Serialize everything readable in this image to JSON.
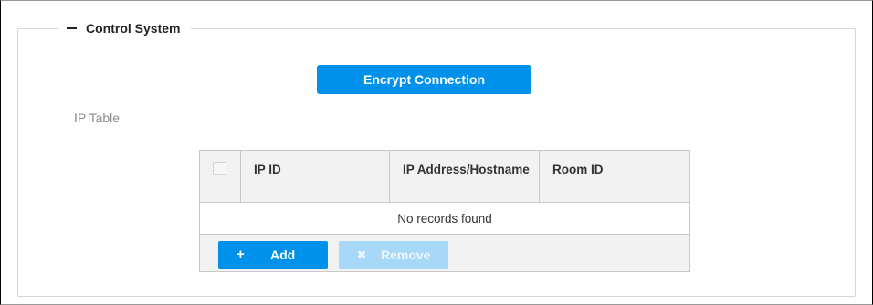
{
  "section": {
    "title": "Control System",
    "collapse_symbol": "−"
  },
  "encrypt_button": {
    "label": "Encrypt Connection"
  },
  "ip_table": {
    "label": "IP Table",
    "columns": [
      "IP ID",
      "IP Address/Hostname",
      "Room ID"
    ],
    "empty_message": "No records found",
    "add_label": "Add",
    "add_icon": "+",
    "remove_label": "Remove",
    "remove_icon": "✖"
  },
  "colors": {
    "primary": "#0091ea",
    "primary_disabled": "#a8d8f8",
    "header_bg": "#f2f2f2"
  },
  "icons": {
    "collapse": "minus-icon",
    "add": "plus-icon",
    "remove": "x-icon"
  }
}
